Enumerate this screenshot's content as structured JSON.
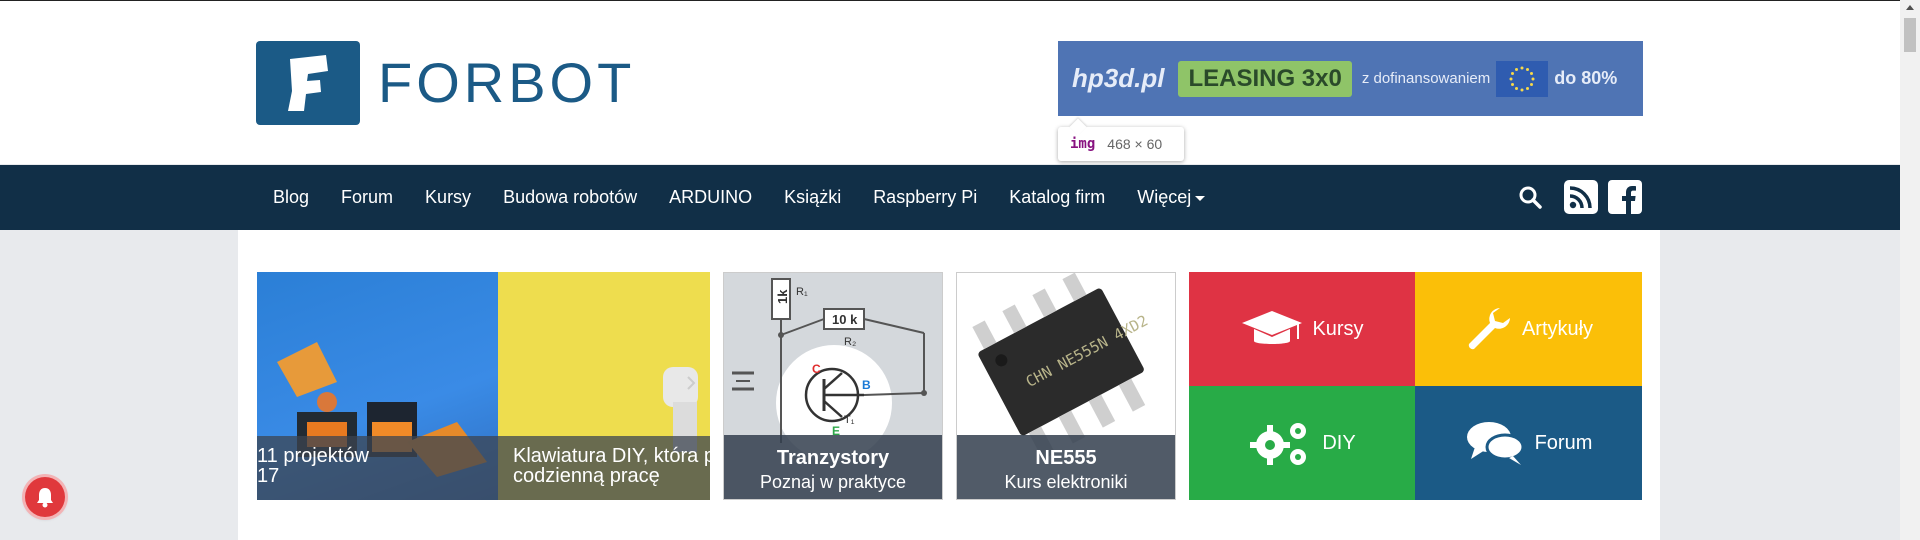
{
  "logo": {
    "text": "FORBOT"
  },
  "banner": {
    "brand": "hp3d.pl",
    "leasing": "LEASING 3x0",
    "subtitle": "z dofinansowaniem",
    "percent": "do 80%"
  },
  "tooltip": {
    "tag": "img",
    "dimensions": "468 × 60"
  },
  "nav": {
    "items": [
      {
        "label": "Blog"
      },
      {
        "label": "Forum"
      },
      {
        "label": "Kursy"
      },
      {
        "label": "Budowa robotów"
      },
      {
        "label": "ARDUINO"
      },
      {
        "label": "Książki"
      },
      {
        "label": "Raspberry Pi"
      },
      {
        "label": "Katalog firm"
      },
      {
        "label": "Więcej"
      }
    ],
    "icons": [
      "search-icon",
      "rss-icon",
      "facebook-icon"
    ]
  },
  "slider": {
    "slide1": {
      "line1": "11 projektów",
      "line2": "17"
    },
    "slide2": {
      "line1": "Klawiatura DIY, która p",
      "line2": "codzienną pracę"
    }
  },
  "cards": {
    "tranzystory": {
      "title": "Tranzystory",
      "subtitle": "Poznaj w praktyce"
    },
    "ne555": {
      "title": "NE555",
      "subtitle": "Kurs elektroniki",
      "chip_text": "CHN NE555N 4XD2"
    }
  },
  "circuit": {
    "r1": "1k",
    "r1_name": "R₁",
    "r2": "10 k",
    "r2_name": "R₂",
    "c": "C",
    "b": "B",
    "e": "E",
    "t": "T₁"
  },
  "quick_links": [
    {
      "label": "Kursy",
      "color": "#df3344",
      "icon": "graduation-cap-icon"
    },
    {
      "label": "Artykuły",
      "color": "#fbbf08",
      "icon": "wrench-icon"
    },
    {
      "label": "DIY",
      "color": "#28ab47",
      "icon": "gears-icon"
    },
    {
      "label": "Forum",
      "color": "#1b5a86",
      "icon": "chat-bubbles-icon"
    }
  ],
  "colors": {
    "nav_bg": "#112f47",
    "brand": "#1b5a86"
  }
}
